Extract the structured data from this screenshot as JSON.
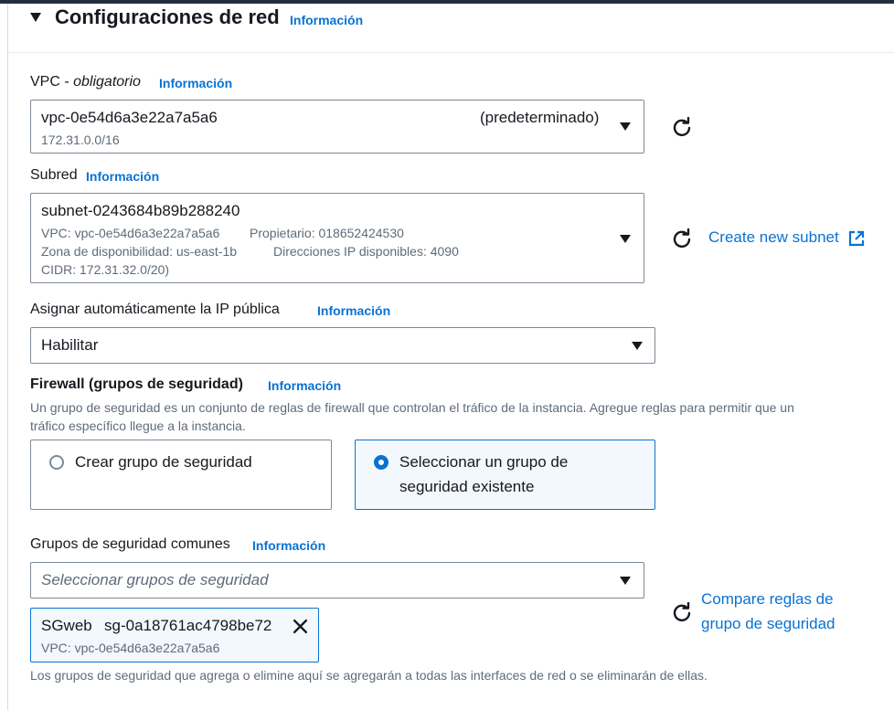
{
  "section": {
    "title": "Configuraciones de red",
    "info": "Información"
  },
  "vpc": {
    "label": "VPC - ",
    "label_em": "obligatorio",
    "info": "Información",
    "value": "vpc-0e54d6a3e22a7a5a6",
    "tag": "(predeterminado)",
    "cidr": "172.31.0.0/16"
  },
  "subnet": {
    "label": "Subred",
    "info": "Información",
    "value": "subnet-0243684b89b288240",
    "line1_vpc": "VPC: vpc-0e54d6a3e22a7a5a6",
    "line1_owner": "Propietario: 018652424530",
    "line2_az": "Zona de disponibilidad: us-east-1b",
    "line2_ips": "Direcciones IP disponibles: 4090",
    "line3_cidr": "CIDR: 172.31.32.0/20)",
    "create_link": "Create new subnet"
  },
  "public_ip": {
    "label": "Asignar automáticamente la IP pública",
    "info": "Información",
    "value": "Habilitar"
  },
  "firewall": {
    "label": "Firewall (grupos de seguridad)",
    "info": "Información",
    "description_1": "Un grupo de seguridad es un conjunto de reglas de firewall que controlan el tráfico de la instancia. Agregue reglas para permitir que un",
    "description_2": "tráfico específico llegue a la instancia.",
    "option_create": "Crear grupo de seguridad",
    "option_select_1": "Seleccionar un grupo de",
    "option_select_2": "seguridad existente"
  },
  "common_groups": {
    "label": "Grupos de seguridad comunes",
    "info": "Información",
    "placeholder": "Seleccionar grupos de seguridad",
    "compare_1": "Compare reglas de",
    "compare_2": "grupo de seguridad",
    "token_name": "SGweb",
    "token_id": "sg-0a18761ac4798be72",
    "token_vpc": "VPC: vpc-0e54d6a3e22a7a5a6",
    "footer": "Los grupos de seguridad que agrega o elimine aquí se agregarán a todas las interfaces de red o se eliminarán de ellas."
  },
  "colors": {
    "link": "#0972d3",
    "text": "#16191f",
    "secondary": "#5f6b7a",
    "border": "#7d8998",
    "selected_bg": "#f2f8fd"
  }
}
